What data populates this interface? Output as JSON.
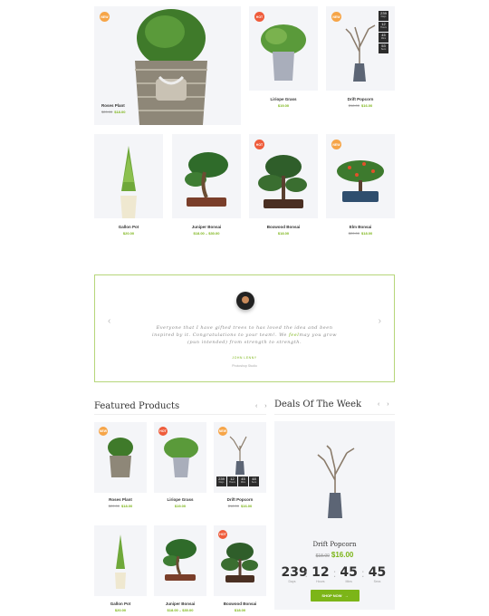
{
  "grid_top": [
    {
      "name": "Roses Plant",
      "old_price": "$20.00",
      "price": "$18.00",
      "badge": "NEW"
    },
    {
      "name": "Liriope Grass",
      "old_price": "",
      "price": "$19.00",
      "badge": "HOT"
    },
    {
      "name": "Drift Popcorn",
      "old_price": "$18.00",
      "price": "$16.00",
      "badge": "NEW",
      "timer": [
        {
          "v": "239",
          "l": "Days"
        },
        {
          "v": "12",
          "l": "Hours"
        },
        {
          "v": "45",
          "l": "Mins"
        },
        {
          "v": "53",
          "l": "Secs"
        }
      ]
    },
    {
      "name": "Gallon Pot",
      "old_price": "",
      "price": "$20.00",
      "badge": ""
    },
    {
      "name": "Juniper Bonsai",
      "old_price": "",
      "price": "$18.00 – $30.00",
      "badge": ""
    },
    {
      "name": "Boxwood Bonsai",
      "old_price": "",
      "price": "$18.00",
      "badge": "HOT"
    },
    {
      "name": "Elm Bonsai",
      "old_price": "$20.00",
      "price": "$18.00",
      "badge": "NEW"
    }
  ],
  "testimonial": {
    "quote_a": "Everyone that I have gifted trees to has loved the idea and been inspired by it. Congratulations to your team!. We ",
    "quote_accent": "feel",
    "quote_b": "may you grow (pun intended) from strength to strength.",
    "author": "JOHN LENNY",
    "role": "Photoshop Studio",
    "prev": "‹",
    "next": "›"
  },
  "featured": {
    "title": "Featured Products",
    "arrows": "‹ ›",
    "items": [
      {
        "name": "Roses Plant",
        "old_price": "$20.00",
        "price": "$18.00",
        "badge": "NEW"
      },
      {
        "name": "Liriope Grass",
        "old_price": "",
        "price": "$19.00",
        "badge": "HOT"
      },
      {
        "name": "Drift Popcorn",
        "old_price": "$18.00",
        "price": "$16.00",
        "badge": "NEW",
        "timer": [
          {
            "v": "239",
            "l": "Days"
          },
          {
            "v": "12",
            "l": "Hours"
          },
          {
            "v": "45",
            "l": "Mins"
          },
          {
            "v": "48",
            "l": "Secs"
          }
        ]
      },
      {
        "name": "Gallon Pot",
        "old_price": "",
        "price": "$20.00",
        "badge": ""
      },
      {
        "name": "Juniper Bonsai",
        "old_price": "",
        "price": "$18.00 – $30.00",
        "badge": ""
      },
      {
        "name": "Boxwood Bonsai",
        "old_price": "",
        "price": "$18.00",
        "badge": "HOT"
      }
    ]
  },
  "deals": {
    "title": "Deals Of The Week",
    "arrows": "‹ ›",
    "name": "Drift Popcorn",
    "old_price": "$18.00",
    "price": "$16.00",
    "countdown": [
      {
        "v": "239",
        "l": "Days"
      },
      {
        "v": "12",
        "l": "Hours"
      },
      {
        "v": "45",
        "l": "Mins"
      },
      {
        "v": "45",
        "l": "Secs"
      }
    ],
    "button": "SHOP NOW",
    "button_icon": "→"
  }
}
